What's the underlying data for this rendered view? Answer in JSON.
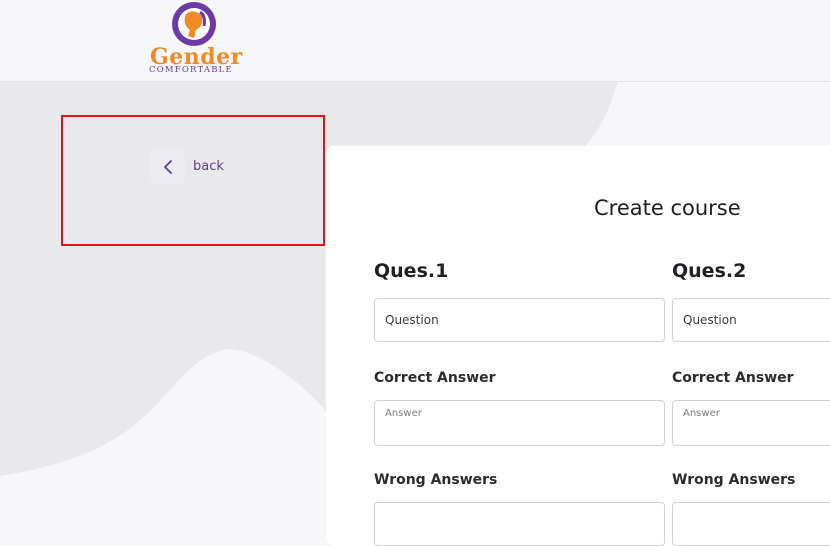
{
  "brand": {
    "name": "Gender",
    "tagline": "COMFORTABLE"
  },
  "nav": {
    "back_label": "back"
  },
  "form": {
    "title": "Create course",
    "questions": [
      {
        "label": "Ques.1",
        "question_placeholder": "Question",
        "correct_label": "Correct Answer",
        "answer_placeholder": "Answer",
        "wrong_label": "Wrong Answers"
      },
      {
        "label": "Ques.2",
        "question_placeholder": "Question",
        "correct_label": "Correct Answer",
        "answer_placeholder": "Answer",
        "wrong_label": "Wrong Answers"
      }
    ]
  },
  "colors": {
    "accent_purple": "#5b3f96",
    "logo_orange": "#f08a24",
    "highlight_red": "#e0141a"
  }
}
